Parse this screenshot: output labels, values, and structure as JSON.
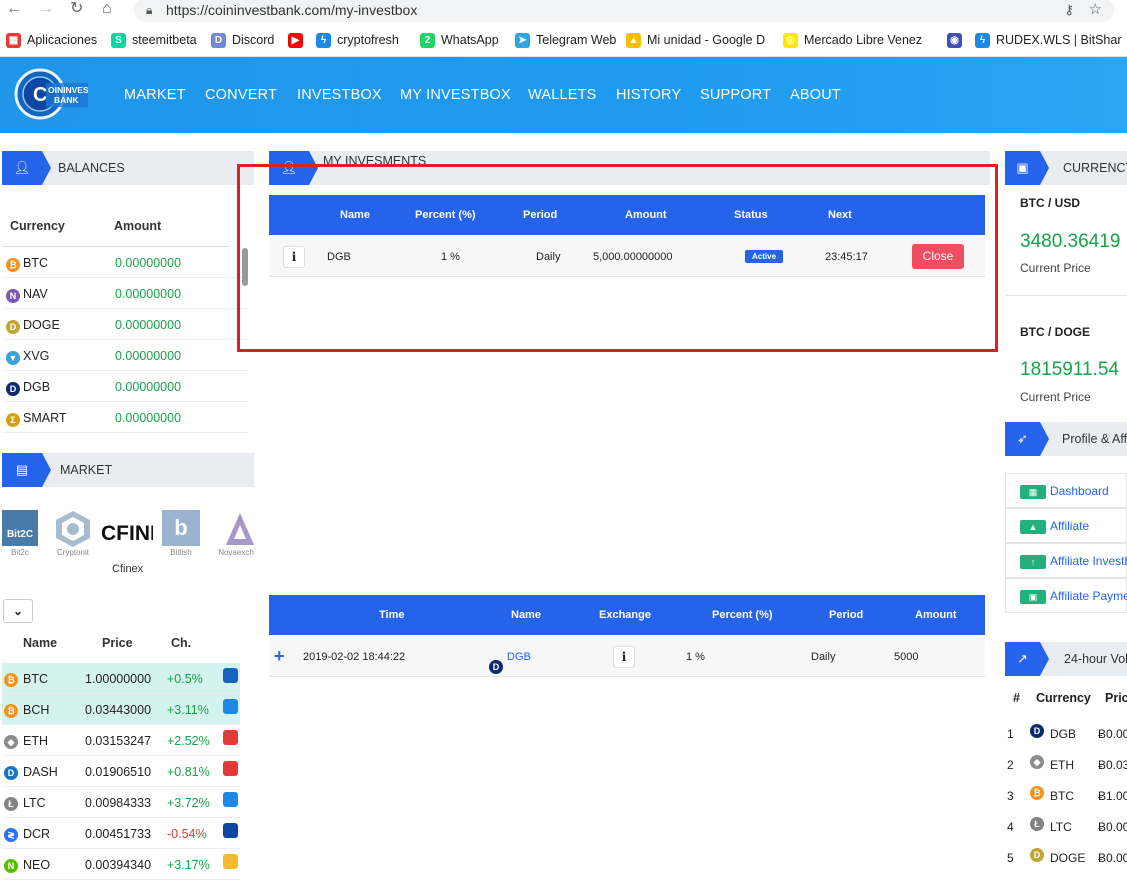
{
  "browser": {
    "url": "https://coininvestbank.com/my-investbox",
    "bookmarks": [
      {
        "label": "Aplicaciones",
        "color": "#e53935",
        "glyph": "▦"
      },
      {
        "label": "steemitbeta",
        "color": "#06d6a0",
        "glyph": "S"
      },
      {
        "label": "Discord",
        "color": "#7289da",
        "glyph": "D"
      },
      {
        "label": "",
        "color": "#ff0000",
        "glyph": "▶"
      },
      {
        "label": "cryptofresh",
        "color": "#1e88e5",
        "glyph": "ϟ"
      },
      {
        "label": "WhatsApp",
        "color": "#25d366",
        "glyph": "2"
      },
      {
        "label": "Telegram Web",
        "color": "#2ca5e0",
        "glyph": "➤"
      },
      {
        "label": "Mi unidad - Google D",
        "color": "#fbbc04",
        "glyph": "▲"
      },
      {
        "label": "Mercado Libre Venez",
        "color": "#ffe600",
        "glyph": "◎"
      },
      {
        "label": "",
        "color": "#3f51b5",
        "glyph": "◉"
      },
      {
        "label": "RUDEX.WLS | BitShar",
        "color": "#1e88e5",
        "glyph": "ϟ"
      }
    ]
  },
  "site": {
    "logo_text": "COIN INVEST BANK",
    "menu": [
      "MARKET",
      "CONVERT",
      "INVESTBOX",
      "MY INVESTBOX",
      "WALLETS",
      "HISTORY",
      "SUPPORT",
      "ABOUT"
    ]
  },
  "balances": {
    "title": "BALANCES",
    "col_currency": "Currency",
    "col_amount": "Amount",
    "rows": [
      {
        "coin": "BTC",
        "amount": "0.00000000",
        "color": "#f7931a",
        "glyph": "₿"
      },
      {
        "coin": "NAV",
        "amount": "0.00000000",
        "color": "#7d59b5",
        "glyph": "N"
      },
      {
        "coin": "DOGE",
        "amount": "0.00000000",
        "color": "#c2a633",
        "glyph": "D"
      },
      {
        "coin": "XVG",
        "amount": "0.00000000",
        "color": "#3ba2d9",
        "glyph": "▼"
      },
      {
        "coin": "DGB",
        "amount": "0.00000000",
        "color": "#0b2a6f",
        "glyph": "D"
      },
      {
        "coin": "SMART",
        "amount": "0.00000000",
        "color": "#d4a017",
        "glyph": "Σ"
      }
    ]
  },
  "market": {
    "title": "MARKET",
    "exchanges": [
      "Bit2c",
      "Cryptonit",
      "Cfinex",
      "Bitlish",
      "Novaexch"
    ],
    "cfinex_logo": "CFINE",
    "col_name": "Name",
    "col_price": "Price",
    "col_change": "Ch.",
    "rows": [
      {
        "coin": "BTC",
        "price": "1.00000000",
        "change": "+0.5%",
        "color": "#f7931a",
        "glyph": "₿",
        "dir": "up"
      },
      {
        "coin": "BCH",
        "price": "0.03443000",
        "change": "+3.11%",
        "color": "#f7931a",
        "glyph": "₿",
        "dir": "up"
      },
      {
        "coin": "ETH",
        "price": "0.03153247",
        "change": "+2.52%",
        "color": "#8c8c8c",
        "glyph": "◆",
        "dir": "up"
      },
      {
        "coin": "DASH",
        "price": "0.01906510",
        "change": "+0.81%",
        "color": "#1c75bc",
        "glyph": "D",
        "dir": "up"
      },
      {
        "coin": "LTC",
        "price": "0.00984333",
        "change": "+3.72%",
        "color": "#838383",
        "glyph": "Ł",
        "dir": "up"
      },
      {
        "coin": "DCR",
        "price": "0.00451733",
        "change": "-0.54%",
        "color": "#2970ff",
        "glyph": "≷",
        "dir": "down"
      },
      {
        "coin": "NEO",
        "price": "0.00394340",
        "change": "+3.17%",
        "color": "#58bf00",
        "glyph": "N",
        "dir": "up"
      }
    ]
  },
  "my_investments": {
    "title": "MY INVESMENTS",
    "headers": [
      "Name",
      "Percent (%)",
      "Period",
      "Amount",
      "Status",
      "Next"
    ],
    "rows": [
      {
        "name": "DGB",
        "percent": "1 %",
        "period": "Daily",
        "amount": "5,000.00000000",
        "status": "Active",
        "next": "23:45:17",
        "action": "Close"
      }
    ]
  },
  "history": {
    "headers": [
      "Time",
      "Name",
      "Exchange",
      "Percent (%)",
      "Period",
      "Amount"
    ],
    "rows": [
      {
        "expand": "+",
        "time": "2019-02-02 18:44:22",
        "name": "DGB",
        "percent": "1 %",
        "period": "Daily",
        "amount": "5000"
      }
    ]
  },
  "currency": {
    "title": "CURRENCY",
    "cards": [
      {
        "pair": "BTC / USD",
        "price": "3480.36419",
        "label": "Current Price"
      },
      {
        "pair": "BTC / DOGE",
        "price": "1815911.54",
        "label": "Current Price"
      }
    ]
  },
  "profile": {
    "title": "Profile & Affi",
    "items": [
      "Dashboard",
      "Affiliate",
      "Affiliate Investb",
      "Affiliate Payme"
    ]
  },
  "volume": {
    "title": "24-hour Vol",
    "col_num": "#",
    "col_currency": "Currency",
    "col_price": "Pric",
    "rows": [
      {
        "n": "1",
        "coin": "DGB",
        "price": "Ƀ0.00",
        "color": "#0b2a6f",
        "glyph": "D"
      },
      {
        "n": "2",
        "coin": "ETH",
        "price": "Ƀ0.03",
        "color": "#8c8c8c",
        "glyph": "◆"
      },
      {
        "n": "3",
        "coin": "BTC",
        "price": "Ƀ1.00",
        "color": "#f7931a",
        "glyph": "₿"
      },
      {
        "n": "4",
        "coin": "LTC",
        "price": "Ƀ0.00",
        "color": "#838383",
        "glyph": "Ł"
      },
      {
        "n": "5",
        "coin": "DOGE",
        "price": "Ƀ0.00",
        "color": "#c2a633",
        "glyph": "D"
      }
    ]
  }
}
